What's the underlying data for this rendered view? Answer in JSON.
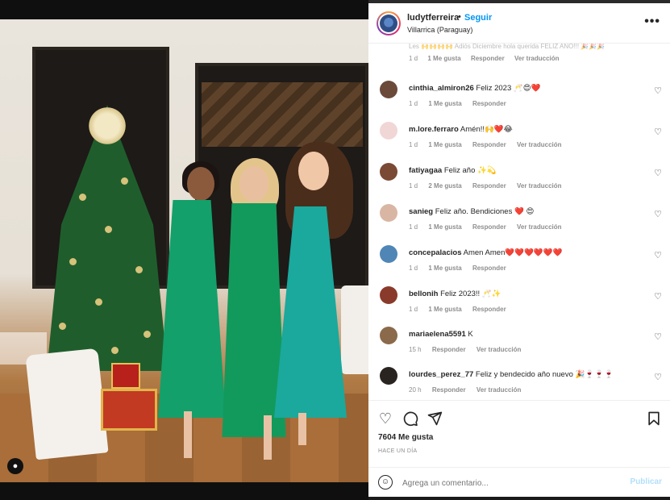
{
  "post": {
    "author": "ludytferreira",
    "separator": "•",
    "follow_label": "Seguir",
    "location": "Villarrica (Paraguay)",
    "more_label": "•••"
  },
  "comments_top": {
    "cut_text": "Les 🙌🙌🙌🙌 Adiós Diciembre hola querida FELIZ AÑO!!! 🎉🎉🎉",
    "time": "1 d",
    "likes": "1 Me gusta",
    "reply": "Responder",
    "translate": "Ver traducción"
  },
  "comments": [
    {
      "user": "cinthia_almiron26",
      "text": "Feliz 2023 🥂😍❤️",
      "time": "1 d",
      "likes": "1 Me gusta",
      "reply": "Responder",
      "translate": "",
      "avatar_color": "#6b4a3a"
    },
    {
      "user": "m.lore.ferraro",
      "text": "Amén!!🙌❤️😂",
      "time": "1 d",
      "likes": "1 Me gusta",
      "reply": "Responder",
      "translate": "Ver traducción",
      "avatar_color": "#f1d6d6"
    },
    {
      "user": "fatiyagaa",
      "text": "Feliz año ✨💫",
      "time": "1 d",
      "likes": "2 Me gusta",
      "reply": "Responder",
      "translate": "Ver traducción",
      "avatar_color": "#7a4a34"
    },
    {
      "user": "sanieg",
      "text": "Feliz año. Bendiciones ❤️ 😍",
      "time": "1 d",
      "likes": "1 Me gusta",
      "reply": "Responder",
      "translate": "Ver traducción",
      "avatar_color": "#d9b6a4"
    },
    {
      "user": "concepalacios",
      "text": "Amen Amen❤️❤️❤️❤️❤️❤️",
      "time": "1 d",
      "likes": "1 Me gusta",
      "reply": "Responder",
      "translate": "",
      "avatar_color": "#4f86b5"
    },
    {
      "user": "bellonih",
      "text": "Feliz 2023!! 🥂✨",
      "time": "1 d",
      "likes": "1 Me gusta",
      "reply": "Responder",
      "translate": "",
      "avatar_color": "#8a3a2a"
    },
    {
      "user": "mariaelena5591",
      "text": "K",
      "time": "15 h",
      "likes": "",
      "reply": "Responder",
      "translate": "Ver traducción",
      "avatar_color": "#8a6a4a"
    },
    {
      "user": "lourdes_perez_77",
      "text": "Feliz y bendecido año nuevo 🎉🍷🍷🍷",
      "time": "20 h",
      "likes": "",
      "reply": "Responder",
      "translate": "Ver traducción",
      "avatar_color": "#2a2420"
    }
  ],
  "actions": {
    "like_icon": "heart-icon",
    "comment_icon": "comment-icon",
    "share_icon": "paper-plane-icon",
    "save_icon": "bookmark-icon",
    "likes_count": "7604 Me gusta",
    "posted_ago": "HACE UN DÍA"
  },
  "add_comment": {
    "placeholder": "Agrega un comentario...",
    "publish_label": "Publicar"
  },
  "colors": {
    "accent": "#0095f6",
    "publish_disabled": "#b2dffc",
    "text_primary": "#262626",
    "text_secondary": "#8e8e8e"
  }
}
